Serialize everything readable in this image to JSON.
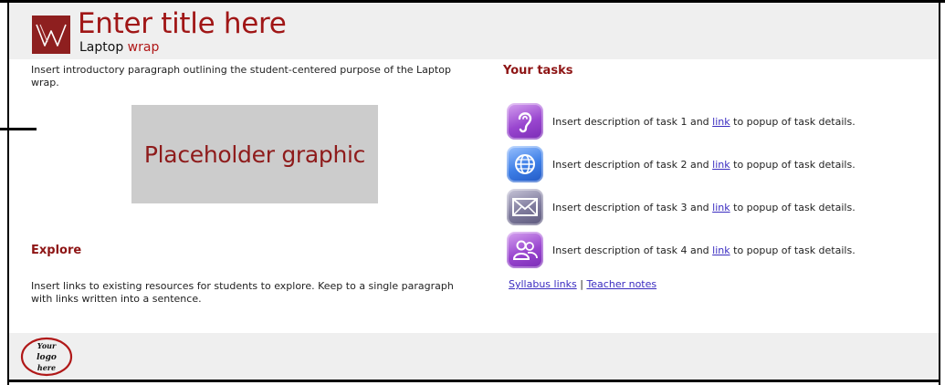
{
  "header": {
    "title": "Enter title here",
    "subtitle_prefix": "Laptop",
    "subtitle_accent": "wrap",
    "logo_letter": "W"
  },
  "intro": {
    "text": "Insert introductory paragraph outlining the student-centered purpose of the Laptop wrap."
  },
  "placeholder": {
    "label": "Placeholder graphic"
  },
  "explore": {
    "heading": "Explore",
    "text": "Insert links to existing resources for students to explore. Keep to a single paragraph with links written into a sentence."
  },
  "tasks": {
    "heading": "Your tasks",
    "items": [
      {
        "icon": "ear-icon",
        "before": "Insert description of task 1 and",
        "link": "link",
        "after": "to popup of task details."
      },
      {
        "icon": "globe-icon",
        "before": "Insert description of task 2 and",
        "link": "link",
        "after": "to popup of task details."
      },
      {
        "icon": "mail-icon",
        "before": "Insert description of task 3 and",
        "link": "link",
        "after": "to popup of task details."
      },
      {
        "icon": "people-icon",
        "before": "Insert description of task 4 and",
        "link": "link",
        "after": "to popup of task details."
      }
    ]
  },
  "bottom_links": {
    "syllabus": "Syllabus links",
    "separator": "|",
    "teacher": "Teacher notes"
  },
  "footer": {
    "logo_lines": [
      "Your",
      "logo",
      "here"
    ]
  },
  "colors": {
    "accent": "#a01616",
    "header_bg": "#efefef",
    "link": "#3a2cc0"
  }
}
